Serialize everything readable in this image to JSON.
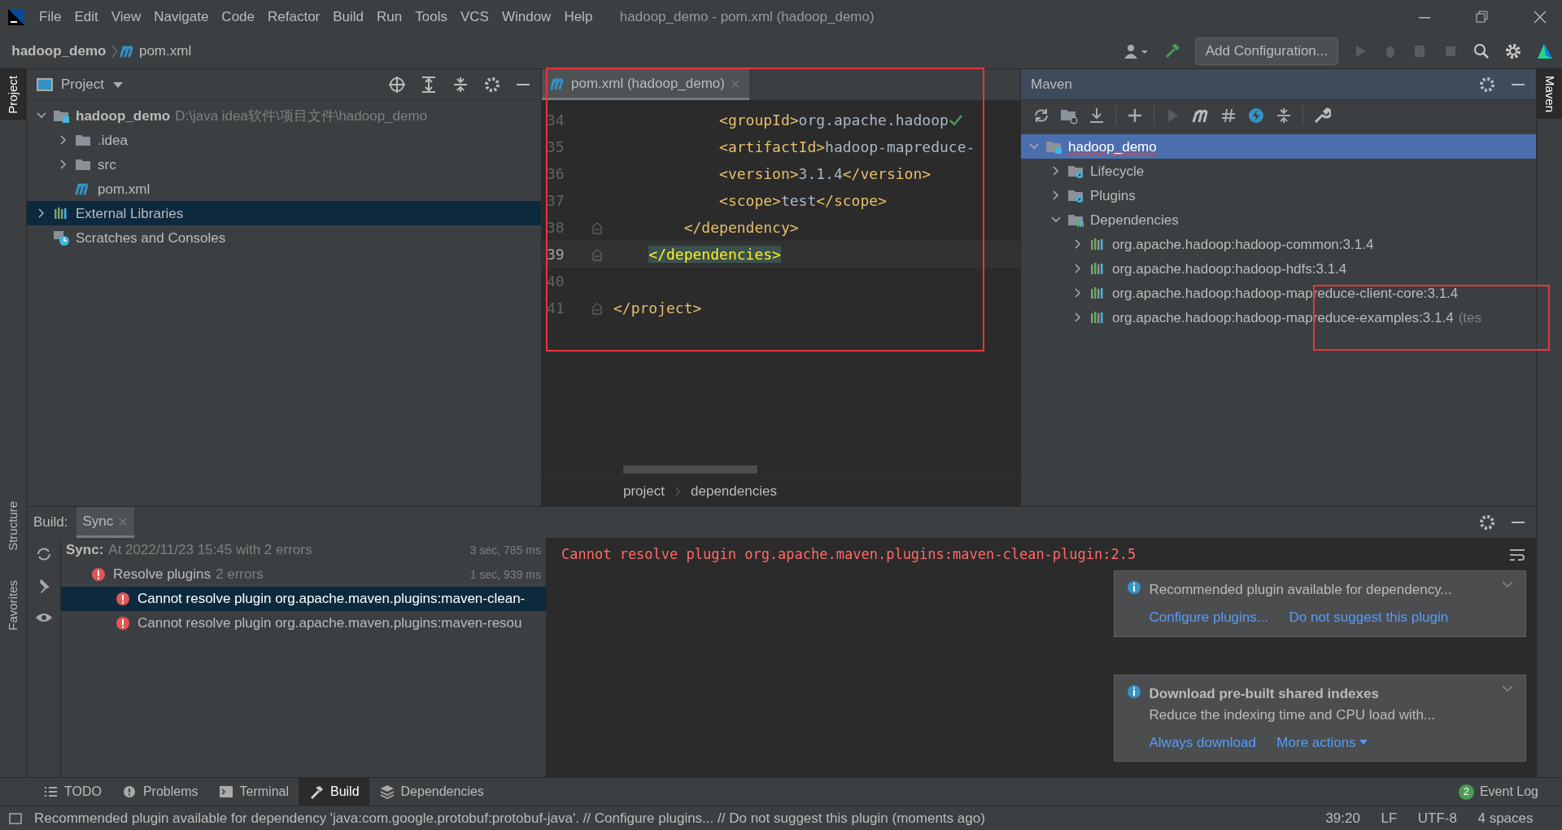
{
  "menu": [
    "File",
    "Edit",
    "View",
    "Navigate",
    "Code",
    "Refactor",
    "Build",
    "Run",
    "Tools",
    "VCS",
    "Window",
    "Help"
  ],
  "window_title": "hadoop_demo - pom.xml (hadoop_demo)",
  "breadcrumb": [
    {
      "label": "hadoop_demo",
      "kind": "project"
    },
    {
      "label": "pom.xml",
      "kind": "maven"
    }
  ],
  "run_config": "Add Configuration...",
  "left_strip": [
    {
      "label": "Project",
      "selected": true
    },
    {
      "label": "Structure",
      "selected": false
    },
    {
      "label": "Favorites",
      "selected": false
    }
  ],
  "right_strip": [
    {
      "label": "Maven",
      "selected": true
    }
  ],
  "project": {
    "title": "Project",
    "tree": [
      {
        "label": "hadoop_demo",
        "path": "D:\\java idea软件\\项目文件\\hadoop_demo",
        "kind": "module",
        "expanded": true,
        "selected": false,
        "children": [
          {
            "label": ".idea",
            "kind": "folder",
            "expanded": false,
            "selected": false
          },
          {
            "label": "src",
            "kind": "folder",
            "expanded": false,
            "selected": false
          },
          {
            "label": "pom.xml",
            "kind": "maven",
            "selected": false
          }
        ]
      },
      {
        "label": "External Libraries",
        "kind": "library",
        "expanded": false,
        "selected": true
      },
      {
        "label": "Scratches and Consoles",
        "kind": "scratches",
        "selected": false
      }
    ]
  },
  "editor": {
    "tab": {
      "label": "pom.xml (hadoop_demo)",
      "selected": true
    },
    "lines": [
      {
        "number": "34",
        "current": false,
        "parts": [
          {
            "kind": "tag",
            "text": "            <groupId>"
          },
          {
            "kind": "text",
            "text": "org.apache.hadoop"
          }
        ]
      },
      {
        "number": "35",
        "current": false,
        "parts": [
          {
            "kind": "tag",
            "text": "            <artifactId>"
          },
          {
            "kind": "text",
            "text": "hadoop-mapreduce-"
          }
        ]
      },
      {
        "number": "36",
        "current": false,
        "parts": [
          {
            "kind": "tag",
            "text": "            <version>"
          },
          {
            "kind": "text",
            "text": "3.1.4"
          },
          {
            "kind": "tag",
            "text": "</version>"
          }
        ]
      },
      {
        "number": "37",
        "current": false,
        "parts": [
          {
            "kind": "tag",
            "text": "            <scope>"
          },
          {
            "kind": "text",
            "text": "test"
          },
          {
            "kind": "tag",
            "text": "</scope>"
          }
        ]
      },
      {
        "number": "38",
        "current": false,
        "parts": [
          {
            "kind": "tag",
            "text": "        </dependency>"
          }
        ]
      },
      {
        "number": "39",
        "current": true,
        "parts": [
          {
            "kind": "match",
            "text": "</dependencies>"
          }
        ]
      },
      {
        "number": "40",
        "current": false
      },
      {
        "number": "41",
        "current": false,
        "parts": [
          {
            "kind": "tag",
            "text": "</project>"
          }
        ]
      }
    ],
    "breadcrumbs": [
      "project",
      "dependencies"
    ]
  },
  "maven": {
    "title": "Maven",
    "tree": [
      {
        "label": "hadoop_demo",
        "kind": "module",
        "expanded": true,
        "selected": true,
        "children": [
          {
            "label": "Lifecycle",
            "kind": "lifecycle",
            "expanded": false,
            "selected": false
          },
          {
            "label": "Plugins",
            "kind": "lifecycle",
            "expanded": false,
            "selected": false
          },
          {
            "label": "Dependencies",
            "kind": "deps",
            "expanded": true,
            "selected": false,
            "children": [
              {
                "label": "org.apache.hadoop:hadoop-common:3.1.4",
                "kind": "library",
                "expanded": false,
                "selected": false
              },
              {
                "label": "org.apache.hadoop:hadoop-hdfs:3.1.4",
                "kind": "library",
                "expanded": false,
                "selected": false
              },
              {
                "label": "org.apache.hadoop:hadoop-mapreduce-client-core:3.1.4",
                "kind": "library",
                "expanded": false,
                "selected": false
              },
              {
                "label": "org.apache.hadoop:hadoop-mapreduce-examples:3.1.4",
                "note": "(tes",
                "kind": "library",
                "expanded": false,
                "selected": false
              }
            ]
          }
        ]
      }
    ]
  },
  "build": {
    "title": "Build:",
    "tab": {
      "label": "Sync",
      "selected": true
    },
    "tree": [
      {
        "label": "Sync:",
        "detail": "At 2022/11/23 15:45 with 2 errors",
        "time": "3 sec, 785 ms",
        "kind": "root",
        "selected": false,
        "children": [
          {
            "label": "Resolve plugins",
            "detail": "2 errors",
            "time": "1 sec, 939 ms",
            "kind": "error",
            "selected": false,
            "children": [
              {
                "label": "Cannot resolve plugin org.apache.maven.plugins:maven-clean-",
                "kind": "error",
                "selected": true
              },
              {
                "label": "Cannot resolve plugin org.apache.maven.plugins:maven-resou",
                "kind": "error",
                "selected": false
              }
            ]
          }
        ]
      }
    ],
    "console": "Cannot resolve plugin org.apache.maven.plugins:maven-clean-plugin:2.5"
  },
  "notifications": [
    {
      "message": "Recommended plugin available for dependency...",
      "actions": [
        {
          "label": "Configure plugins...",
          "dropdown": false
        },
        {
          "label": "Do not suggest this plugin",
          "dropdown": false
        }
      ]
    },
    {
      "title": "Download pre-built shared indexes",
      "message": "Reduce the indexing time and CPU load with...",
      "actions": [
        {
          "label": "Always download",
          "dropdown": false
        },
        {
          "label": "More actions",
          "dropdown": true
        }
      ]
    }
  ],
  "bottom_tabs": [
    {
      "label": "TODO",
      "kind": "list",
      "selected": false
    },
    {
      "label": "Problems",
      "kind": "info",
      "selected": false
    },
    {
      "label": "Terminal",
      "kind": "terminal",
      "selected": false
    },
    {
      "label": "Build",
      "kind": "hammer",
      "selected": true
    },
    {
      "label": "Dependencies",
      "kind": "layers",
      "selected": false
    }
  ],
  "event_log": {
    "count": "2",
    "label": "Event Log"
  },
  "status_bar": {
    "message": "Recommended plugin available for dependency 'java:com.google.protobuf:protobuf-java'. // Configure plugins... // Do not suggest this plugin (moments ago)",
    "position": "39:20",
    "line_ending": "LF",
    "encoding": "UTF-8",
    "indent": "4 spaces"
  }
}
